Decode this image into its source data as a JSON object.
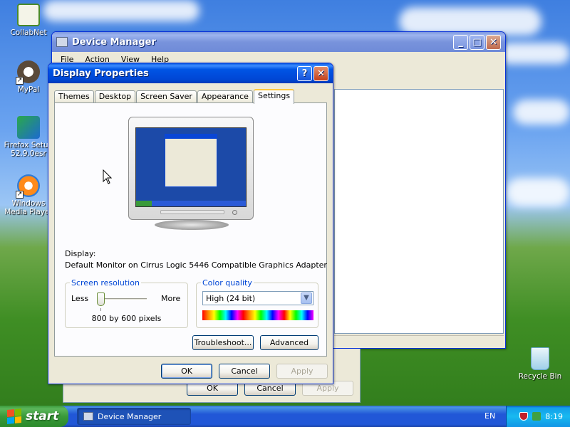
{
  "desktop": {
    "icons": [
      {
        "label": "CollabNet",
        "color": "#ffffff"
      },
      {
        "label": "MyPal",
        "color": "#5a4a3a"
      },
      {
        "label": "Firefox Setup 52.9.0esr",
        "color": "#2aa84a"
      },
      {
        "label": "Windows Media Player",
        "color": "#ff8a1a"
      },
      {
        "label": "Recycle Bin",
        "color": "#cfe8f5"
      }
    ]
  },
  "device_manager": {
    "title": "Device Manager",
    "menu": [
      "File",
      "Action",
      "View",
      "Help"
    ],
    "buttons": {
      "ok": "OK",
      "cancel": "Cancel",
      "apply": "Apply"
    }
  },
  "display_properties": {
    "title": "Display Properties",
    "tabs": [
      "Themes",
      "Desktop",
      "Screen Saver",
      "Appearance",
      "Settings"
    ],
    "selected_tab": "Settings",
    "display_label": "Display:",
    "display_value": "Default Monitor on Cirrus Logic 5446 Compatible Graphics Adapter",
    "screen_resolution": {
      "legend": "Screen resolution",
      "less": "Less",
      "more": "More",
      "value": "800 by 600 pixels",
      "slider_level": 0
    },
    "color_quality": {
      "legend": "Color quality",
      "selected": "High (24 bit)"
    },
    "buttons": {
      "troubleshoot": "Troubleshoot...",
      "advanced": "Advanced",
      "ok": "OK",
      "cancel": "Cancel",
      "apply": "Apply"
    }
  },
  "taskbar": {
    "start_label": "start",
    "task_label": "Device Manager",
    "language": "EN",
    "clock": "8:19"
  },
  "colors": {
    "xp_blue": "#0046d5",
    "start_green": "#3a9a3a",
    "dialog_bg": "#ece9d8"
  }
}
